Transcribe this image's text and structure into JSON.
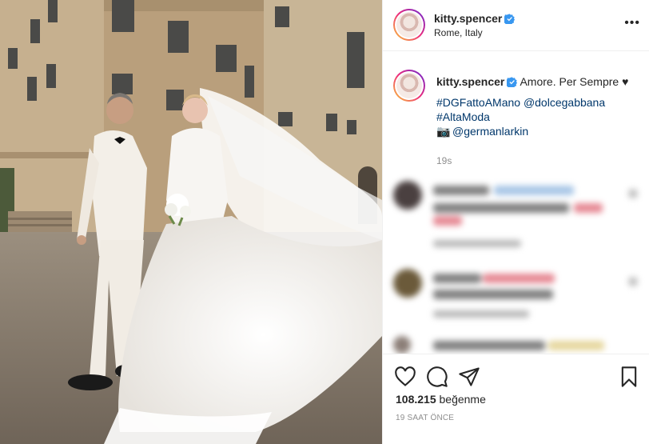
{
  "post": {
    "username": "kitty.spencer",
    "location": "Rome, Italy",
    "more_label": "•••"
  },
  "caption": {
    "username": "kitty.spencer",
    "text": "Amore. Per Sempre ♥",
    "line1": "#DGFattoAMano @dolcegabbana",
    "line2": "#AltaModa",
    "line3_icon": "📷",
    "line3": "@germanlarkin",
    "time": "19s"
  },
  "comments": [
    {
      "state": "blurred",
      "avatar_color": "#4a4040"
    },
    {
      "state": "blurred",
      "avatar_color": "#6b5a3a"
    },
    {
      "state": "blurred",
      "avatar_color": "#8c7f78"
    }
  ],
  "actions": {
    "like_icon": "heart-icon",
    "comment_icon": "comment-icon",
    "share_icon": "paper-plane-icon",
    "save_icon": "bookmark-icon"
  },
  "likes": {
    "count": "108.215",
    "word": "beğenme"
  },
  "posted_time": "19 SAAT ÖNCE",
  "colors": {
    "link": "#00376b",
    "verified": "#3897f0",
    "muted": "#8e8e8e",
    "text": "#262626"
  }
}
